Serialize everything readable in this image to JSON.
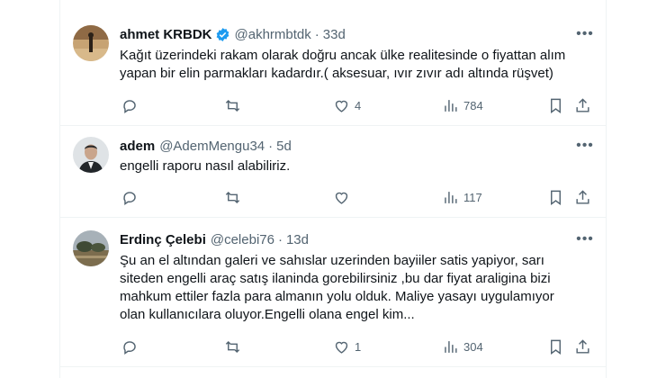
{
  "tweets": [
    {
      "name": "ahmet KRBDK",
      "verified": true,
      "handle": "@akhrmbtdk",
      "separator": "·",
      "time": "33d",
      "text": "Kağıt üzerindeki rakam olarak doğru ancak ülke realitesinde o fiyattan alım\nyapan bir elin parmakları kadardır.( aksesuar, ıvır zıvır adı altında rüşvet)",
      "replies": "",
      "reposts": "",
      "likes": "4",
      "views": "784"
    },
    {
      "name": "adem",
      "verified": false,
      "handle": "@AdemMengu34",
      "separator": "·",
      "time": "5d",
      "text": "engelli raporu nasıl alabiliriz.",
      "replies": "",
      "reposts": "",
      "likes": "",
      "views": "117"
    },
    {
      "name": "Erdinç Çelebi",
      "verified": false,
      "handle": "@celebi76",
      "separator": "·",
      "time": "13d",
      "text": "Şu an el altından galeri ve sahıslar uzerinden bayiiler satis yapiyor, sarı\nsiteden engelli araç satış ilaninda gorebilirsiniz ,bu dar fiyat araligina bizi\nmahkum ettiler fazla para almanın yolu olduk. Maliye yasayı uygulamıyor\nolan kullanıcılara oluyor.Engelli olana engel kim...",
      "replies": "",
      "reposts": "",
      "likes": "1",
      "views": "304"
    }
  ],
  "icons": {
    "reply": "reply-icon",
    "repost": "repost-icon",
    "like": "heart-icon",
    "views": "views-icon",
    "bookmark": "bookmark-icon",
    "share": "share-icon",
    "more": "more-icon",
    "verified": "verified-badge-icon"
  },
  "colors": {
    "text": "#0f1419",
    "secondary": "#536471",
    "verified": "#1d9bf0",
    "border": "#eff3f4"
  }
}
